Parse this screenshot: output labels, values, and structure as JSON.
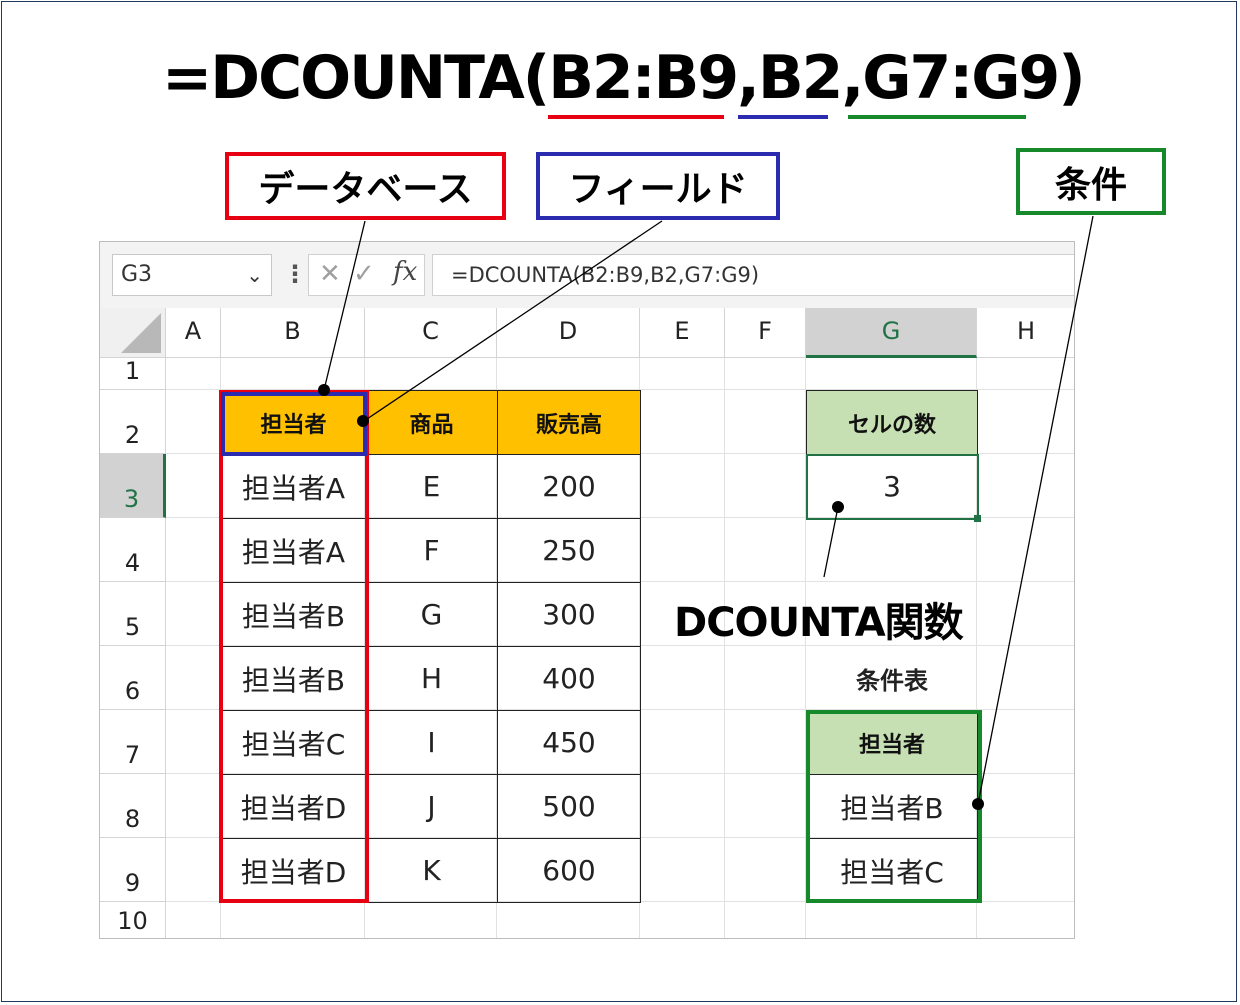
{
  "title": {
    "eq": "=",
    "func": "DCOUNTA",
    "open": "(",
    "arg1": "B2:B9",
    "c1": ",",
    "arg2": "B2",
    "c2": ",",
    "arg3": "G7:G9",
    "close": ")"
  },
  "callouts": {
    "database": "データベース",
    "field": "フィールド",
    "criteria": "条件"
  },
  "colors": {
    "database": "#e60012",
    "field": "#2b2bb0",
    "criteria": "#168a2a",
    "header_orange": "#ffc000",
    "header_green": "#c6e0b4",
    "excel_green": "#217346"
  },
  "formula_bar": {
    "name_box": "G3",
    "cancel_icon": "✕",
    "enter_icon": "✓",
    "fx_icon": "fx",
    "formula": "=DCOUNTA(B2:B9,B2,G7:G9)"
  },
  "columns": [
    "A",
    "B",
    "C",
    "D",
    "E",
    "F",
    "G",
    "H"
  ],
  "rows": [
    "1",
    "2",
    "3",
    "4",
    "5",
    "6",
    "7",
    "8",
    "9",
    "10"
  ],
  "selected_cell": "G3",
  "table": {
    "headers": [
      "担当者",
      "商品",
      "販売高"
    ],
    "rows": [
      [
        "担当者A",
        "E",
        "200"
      ],
      [
        "担当者A",
        "F",
        "250"
      ],
      [
        "担当者B",
        "G",
        "300"
      ],
      [
        "担当者B",
        "H",
        "400"
      ],
      [
        "担当者C",
        "I",
        "450"
      ],
      [
        "担当者D",
        "J",
        "500"
      ],
      [
        "担当者D",
        "K",
        "600"
      ]
    ]
  },
  "result": {
    "header": "セルの数",
    "value": "3",
    "label": "DCOUNTA関数"
  },
  "criteria_table": {
    "title": "条件表",
    "header": "担当者",
    "values": [
      "担当者B",
      "担当者C"
    ]
  }
}
